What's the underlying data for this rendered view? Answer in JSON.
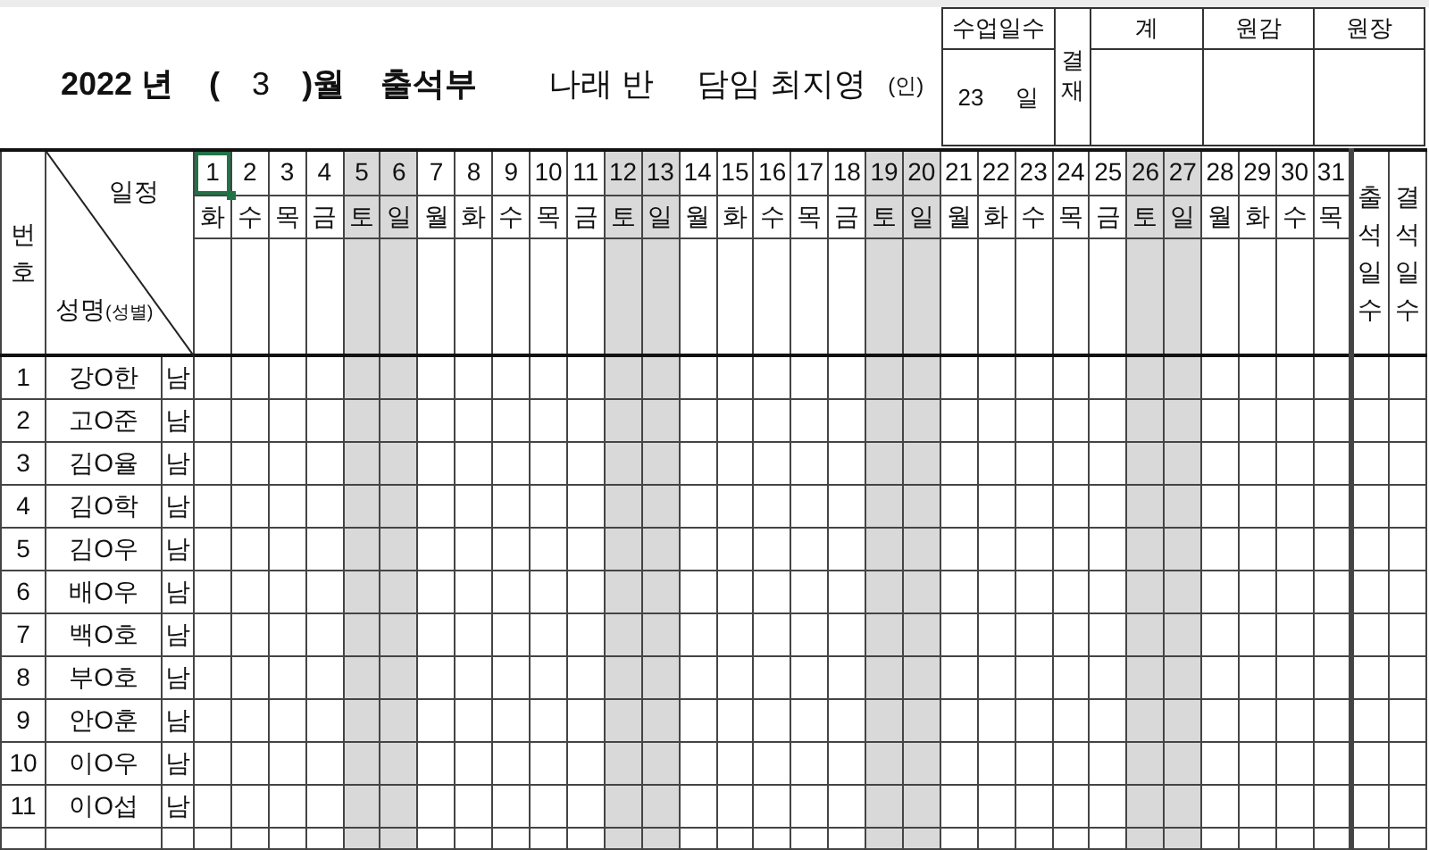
{
  "title": {
    "year": "2022 년",
    "open": "(",
    "month": "3",
    "close": ")월",
    "name": "출석부"
  },
  "class_name": "나래 반",
  "teacher": "담임 최지영",
  "seal": "(인)",
  "school_days": {
    "label": "수업일수",
    "value": "23",
    "unit": "일"
  },
  "approval": {
    "label": "결재",
    "columns": [
      "계",
      "원감",
      "원장"
    ]
  },
  "header": {
    "number": "번호",
    "schedule": "일정",
    "name": "성명",
    "gender": "(성별)"
  },
  "days": [
    {
      "date": "1",
      "weekday": "화",
      "weekend": false,
      "selected": true
    },
    {
      "date": "2",
      "weekday": "수",
      "weekend": false,
      "selected": false
    },
    {
      "date": "3",
      "weekday": "목",
      "weekend": false,
      "selected": false
    },
    {
      "date": "4",
      "weekday": "금",
      "weekend": false,
      "selected": false
    },
    {
      "date": "5",
      "weekday": "토",
      "weekend": true,
      "selected": false
    },
    {
      "date": "6",
      "weekday": "일",
      "weekend": true,
      "selected": false
    },
    {
      "date": "7",
      "weekday": "월",
      "weekend": false,
      "selected": false
    },
    {
      "date": "8",
      "weekday": "화",
      "weekend": false,
      "selected": false
    },
    {
      "date": "9",
      "weekday": "수",
      "weekend": false,
      "selected": false
    },
    {
      "date": "10",
      "weekday": "목",
      "weekend": false,
      "selected": false
    },
    {
      "date": "11",
      "weekday": "금",
      "weekend": false,
      "selected": false
    },
    {
      "date": "12",
      "weekday": "토",
      "weekend": true,
      "selected": false
    },
    {
      "date": "13",
      "weekday": "일",
      "weekend": true,
      "selected": false
    },
    {
      "date": "14",
      "weekday": "월",
      "weekend": false,
      "selected": false
    },
    {
      "date": "15",
      "weekday": "화",
      "weekend": false,
      "selected": false
    },
    {
      "date": "16",
      "weekday": "수",
      "weekend": false,
      "selected": false
    },
    {
      "date": "17",
      "weekday": "목",
      "weekend": false,
      "selected": false
    },
    {
      "date": "18",
      "weekday": "금",
      "weekend": false,
      "selected": false
    },
    {
      "date": "19",
      "weekday": "토",
      "weekend": true,
      "selected": false
    },
    {
      "date": "20",
      "weekday": "일",
      "weekend": true,
      "selected": false
    },
    {
      "date": "21",
      "weekday": "월",
      "weekend": false,
      "selected": false
    },
    {
      "date": "22",
      "weekday": "화",
      "weekend": false,
      "selected": false
    },
    {
      "date": "23",
      "weekday": "수",
      "weekend": false,
      "selected": false
    },
    {
      "date": "24",
      "weekday": "목",
      "weekend": false,
      "selected": false
    },
    {
      "date": "25",
      "weekday": "금",
      "weekend": false,
      "selected": false
    },
    {
      "date": "26",
      "weekday": "토",
      "weekend": true,
      "selected": false
    },
    {
      "date": "27",
      "weekday": "일",
      "weekend": true,
      "selected": false
    },
    {
      "date": "28",
      "weekday": "월",
      "weekend": false,
      "selected": false
    },
    {
      "date": "29",
      "weekday": "화",
      "weekend": false,
      "selected": false
    },
    {
      "date": "30",
      "weekday": "수",
      "weekend": false,
      "selected": false
    },
    {
      "date": "31",
      "weekday": "목",
      "weekend": false,
      "selected": false
    }
  ],
  "totals": [
    "출석일수",
    "결석일수"
  ],
  "students": [
    {
      "number": "1",
      "name": "강O한",
      "gender": "남"
    },
    {
      "number": "2",
      "name": "고O준",
      "gender": "남"
    },
    {
      "number": "3",
      "name": "김O율",
      "gender": "남"
    },
    {
      "number": "4",
      "name": "김O학",
      "gender": "남"
    },
    {
      "number": "5",
      "name": "김O우",
      "gender": "남"
    },
    {
      "number": "6",
      "name": "배O우",
      "gender": "남"
    },
    {
      "number": "7",
      "name": "백O호",
      "gender": "남"
    },
    {
      "number": "8",
      "name": "부O호",
      "gender": "남"
    },
    {
      "number": "9",
      "name": "안O훈",
      "gender": "남"
    },
    {
      "number": "10",
      "name": "이O우",
      "gender": "남"
    },
    {
      "number": "11",
      "name": "이O섭",
      "gender": "남"
    }
  ]
}
